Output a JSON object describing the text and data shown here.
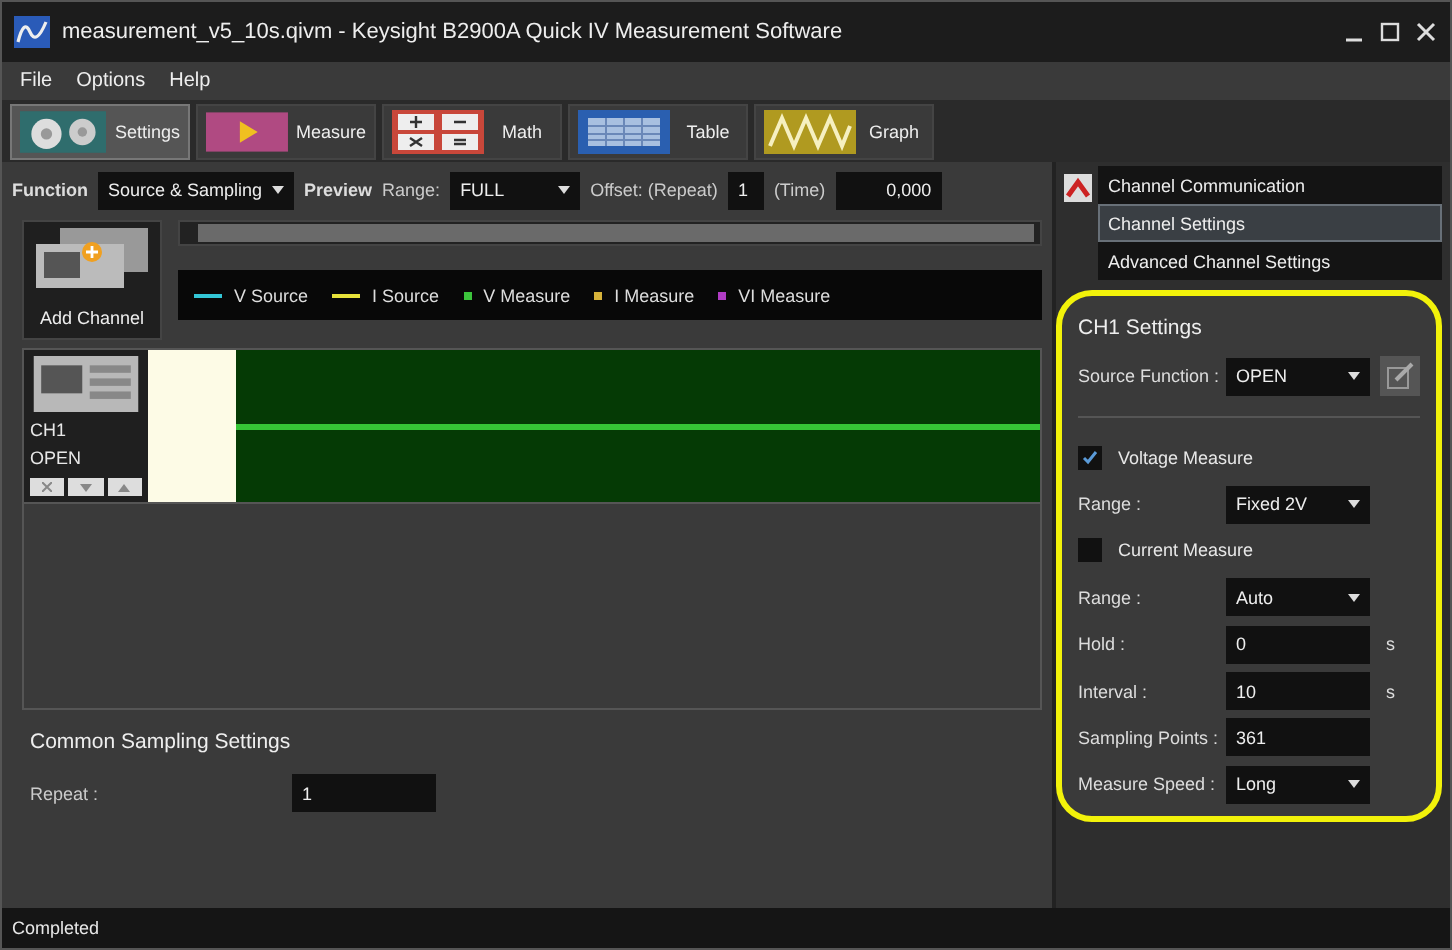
{
  "window": {
    "title": "measurement_v5_10s.qivm - Keysight B2900A Quick IV Measurement Software"
  },
  "menu": [
    "File",
    "Options",
    "Help"
  ],
  "toolbar": [
    {
      "label": "Settings",
      "kind": "settings",
      "selected": true
    },
    {
      "label": "Measure",
      "kind": "measure",
      "selected": false
    },
    {
      "label": "Math",
      "kind": "math",
      "selected": false
    },
    {
      "label": "Table",
      "kind": "table",
      "selected": false
    },
    {
      "label": "Graph",
      "kind": "graph",
      "selected": false
    }
  ],
  "function_bar": {
    "function_label": "Function",
    "function_value": "Source & Sampling",
    "preview_label": "Preview",
    "range_label": "Range:",
    "range_value": "FULL",
    "offset_label": "Offset: (Repeat)",
    "offset_value": "1",
    "time_label": "(Time)",
    "time_value": "0,000"
  },
  "add_channel": {
    "label": "Add Channel"
  },
  "legend": [
    {
      "label": "V Source",
      "kind": "line",
      "color": "#33c6d6"
    },
    {
      "label": "I Source",
      "kind": "line",
      "color": "#e6e23a"
    },
    {
      "label": "V Measure",
      "kind": "dot",
      "color": "#3cc43c"
    },
    {
      "label": "I Measure",
      "kind": "dot",
      "color": "#d6b23a"
    },
    {
      "label": "VI Measure",
      "kind": "dot",
      "color": "#b03cc4"
    }
  ],
  "channels": [
    {
      "name": "CH1",
      "state": "OPEN"
    }
  ],
  "common": {
    "title": "Common Sampling Settings",
    "repeat_label": "Repeat :",
    "repeat_value": "1"
  },
  "side_tabs": [
    {
      "label": "Channel Communication",
      "selected": false
    },
    {
      "label": "Channel Settings",
      "selected": true
    },
    {
      "label": "Advanced Channel Settings",
      "selected": false
    }
  ],
  "ch_settings": {
    "title": "CH1 Settings",
    "source_label": "Source Function :",
    "source_value": "OPEN",
    "fields": [
      {
        "kind": "check",
        "label": "Voltage Measure",
        "checked": true
      },
      {
        "kind": "select",
        "label": "Range :",
        "value": "Fixed 2V"
      },
      {
        "kind": "check",
        "label": "Current Measure",
        "checked": false
      },
      {
        "kind": "select",
        "label": "Range :",
        "value": "Auto"
      },
      {
        "kind": "input",
        "label": "Hold :",
        "value": "0",
        "unit": "s"
      },
      {
        "kind": "input",
        "label": "Interval :",
        "value": "10",
        "unit": "s"
      },
      {
        "kind": "input",
        "label": "Sampling Points :",
        "value": "361"
      },
      {
        "kind": "select",
        "label": "Measure Speed :",
        "value": "Long"
      }
    ]
  },
  "status_bar": {
    "text": "Completed"
  }
}
